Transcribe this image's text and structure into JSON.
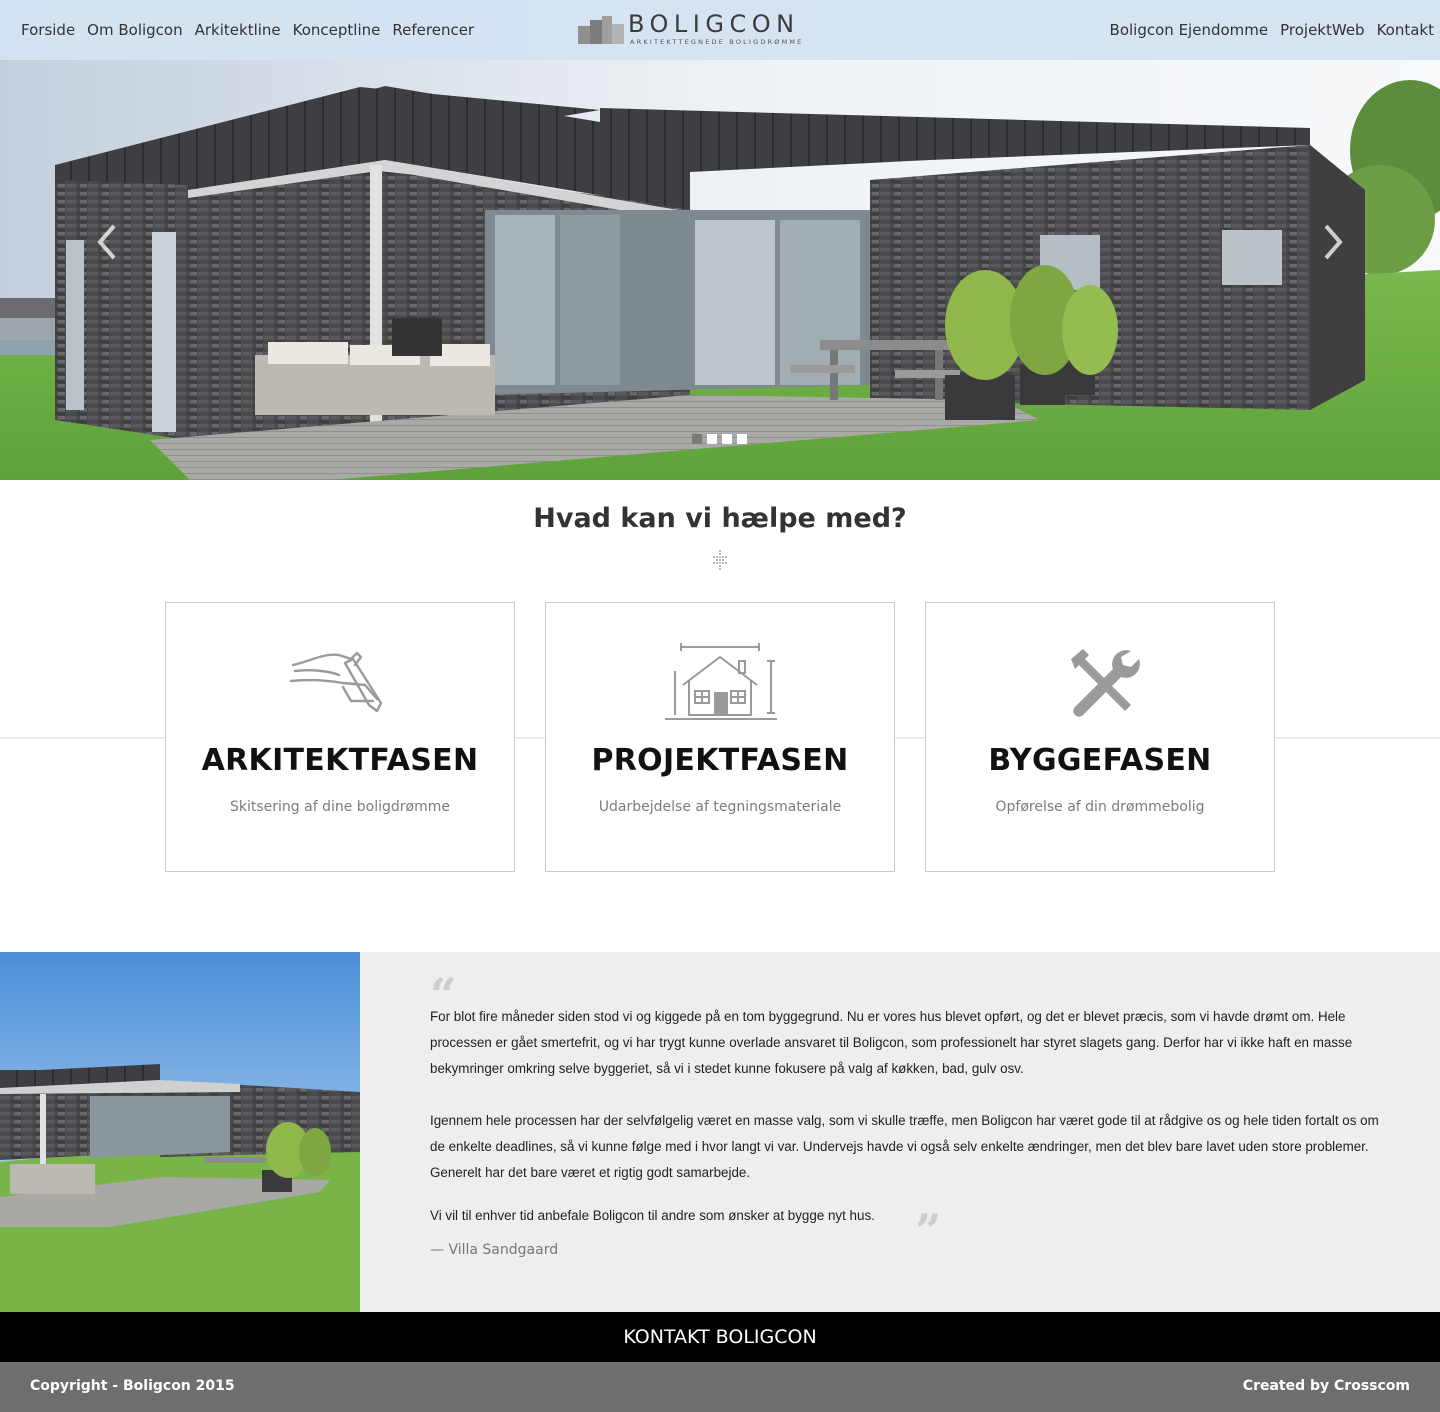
{
  "nav_left": [
    "Forside",
    "Om Boligcon",
    "Arkitektline",
    "Konceptline",
    "Referencer"
  ],
  "nav_right": [
    "Boligcon Ejendomme",
    "ProjektWeb",
    "Kontakt"
  ],
  "logo": {
    "name": "BOLIGCON",
    "tagline": "ARKITEKTTEGNEDE BOLIGDRØMME"
  },
  "slider": {
    "slides": 4,
    "active": 1,
    "prev_icon": "chevron-left-icon",
    "next_icon": "chevron-right-icon"
  },
  "services": {
    "heading": "Hvad kan vi hælpe med?",
    "cards": [
      {
        "title": "ARKITEKTFASEN",
        "subtitle": "Skitsering af dine boligdrømme",
        "icon": "hand-drawing-icon"
      },
      {
        "title": "PROJEKTFASEN",
        "subtitle": "Udarbejdelse af tegningsmateriale",
        "icon": "house-plan-icon"
      },
      {
        "title": "BYGGEFASEN",
        "subtitle": "Opførelse af din drømmebolig",
        "icon": "tools-icon"
      }
    ]
  },
  "testimonial": {
    "paragraphs": [
      "For blot fire måneder siden stod vi og kiggede på en tom byggegrund. Nu er vores hus blevet opført, og det er blevet præcis, som vi havde drømt om. Hele processen er gået smertefrit, og vi har trygt kunne overlade ansvaret til Boligcon, som professionelt har styret slagets gang. Derfor har vi ikke haft en masse bekymringer omkring selve byggeriet, så vi i stedet kunne fokusere på valg af køkken, bad, gulv osv.",
      "Igennem hele processen har der selvfølgelig været en masse valg, som vi skulle træffe, men Boligcon har været gode til at rådgive os og hele tiden fortalt os om de enkelte deadlines, så vi kunne følge med i hvor langt vi var. Undervejs havde vi også selv enkelte ændringer, men det blev bare lavet uden store problemer. Generelt har det bare været et rigtig godt samarbejde."
    ],
    "closing": "Vi vil til enhver tid anbefale Boligcon til andre som ønsker at bygge nyt hus.",
    "author": "— Villa Sandgaard"
  },
  "cta_label": "KONTAKT BOLIGCON",
  "footer": {
    "copyright": "Copyright - Boligcon 2015",
    "credit": "Created by Crosscom"
  },
  "colors": {
    "header_bg": "#d4e2f2",
    "cta_bg": "#000000",
    "footer_bg": "#6e6e6e",
    "testimonial_bg": "#eeeeee"
  }
}
